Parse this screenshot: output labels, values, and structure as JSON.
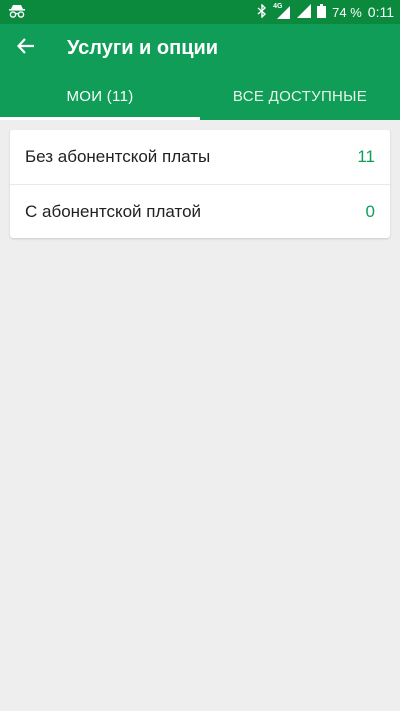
{
  "status_bar": {
    "network": "4G",
    "battery_percent": "74 %",
    "time": "0:11"
  },
  "app_bar": {
    "title": "Услуги и опции",
    "back_icon": "arrow-left-icon"
  },
  "tabs": [
    {
      "label": "МОИ (11)",
      "active": true
    },
    {
      "label": "ВСЕ ДОСТУПНЫЕ",
      "active": false
    }
  ],
  "categories": [
    {
      "label": "Без абонентской платы",
      "count": "11"
    },
    {
      "label": "С абонентской платой",
      "count": "0"
    }
  ],
  "colors": {
    "primary": "#0f9d58",
    "status_bar": "#0b8a3e",
    "background": "#eeeeee"
  }
}
